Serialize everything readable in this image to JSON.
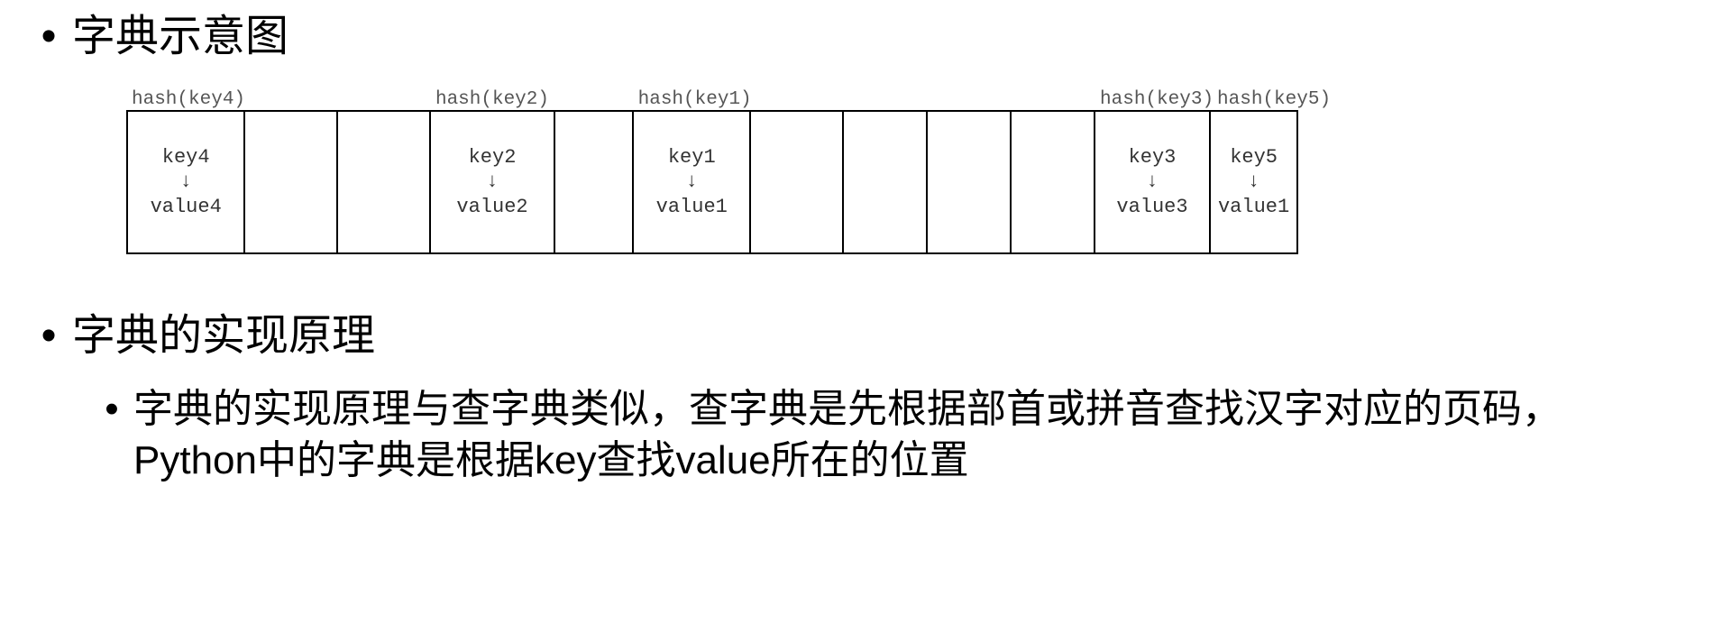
{
  "heading1": "字典示意图",
  "heading2": "字典的实现原理",
  "sub_text": "字典的实现原理与查字典类似，查字典是先根据部首或拼音查找汉字对应的页码，Python中的字典是根据key查找value所在的位置",
  "bullet_glyph": "•",
  "arrow_glyph": "↓",
  "slots": [
    {
      "hash": "hash(key4)",
      "key": "key4",
      "value": "value4"
    },
    {
      "hash": "",
      "key": "",
      "value": ""
    },
    {
      "hash": "",
      "key": "",
      "value": ""
    },
    {
      "hash": "hash(key2)",
      "key": "key2",
      "value": "value2"
    },
    {
      "hash": "",
      "key": "",
      "value": ""
    },
    {
      "hash": "hash(key1)",
      "key": "key1",
      "value": "value1"
    },
    {
      "hash": "",
      "key": "",
      "value": ""
    },
    {
      "hash": "",
      "key": "",
      "value": ""
    },
    {
      "hash": "",
      "key": "",
      "value": ""
    },
    {
      "hash": "",
      "key": "",
      "value": ""
    },
    {
      "hash": "hash(key3)",
      "key": "key3",
      "value": "value3"
    },
    {
      "hash": "hash(key5)",
      "key": "key5",
      "value": "value1"
    }
  ]
}
